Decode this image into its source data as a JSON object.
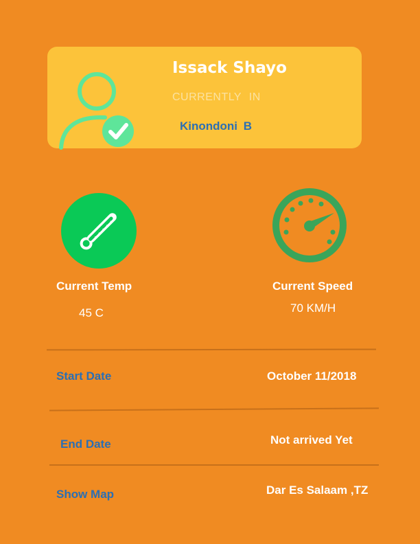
{
  "profile": {
    "name": "Issack Shayo",
    "status_text": "CURRENTLY IN",
    "location": "Kinondoni B"
  },
  "stats": {
    "temp_label": "Current Temp",
    "temp_value": "45 C",
    "speed_label": "Current Speed",
    "speed_value": "70 KM/H"
  },
  "rows": {
    "start_label": "Start Date",
    "start_value": "October 11/2018",
    "end_label": "End Date",
    "end_value": "Not arrived Yet",
    "map_label": "Show Map",
    "map_value": "Dar Es Salaam ,TZ"
  },
  "colors": {
    "background": "#f08b22",
    "card": "#fcc33a",
    "accent_blue": "#2b6fb4",
    "green": "#0ac956",
    "gauge_green": "#3aa55a",
    "avatar_mint": "#5ee59a"
  },
  "icons": {
    "avatar": "user-check-icon",
    "temperature": "thermometer-icon",
    "speed": "speedometer-icon"
  }
}
